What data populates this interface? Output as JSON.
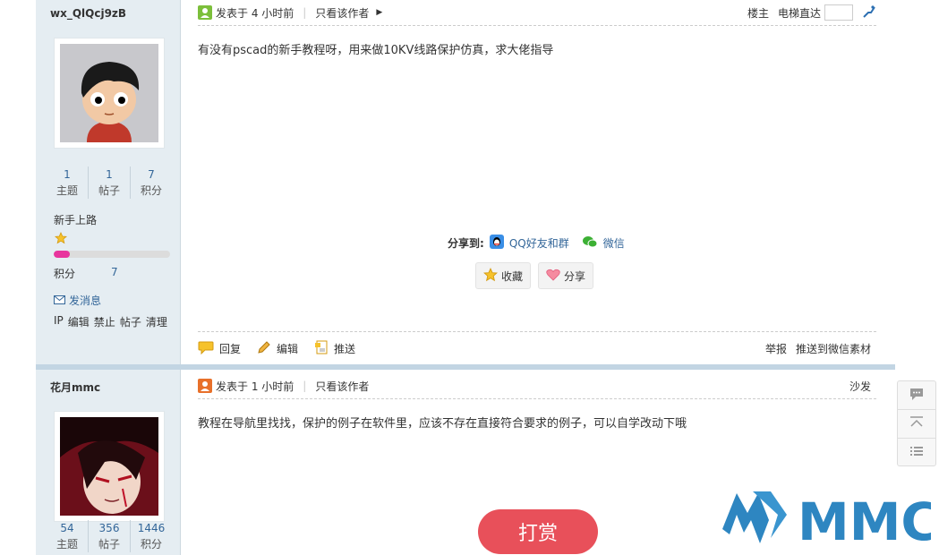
{
  "posts": [
    {
      "author": {
        "name": "wx_QlQcj9zB",
        "stats": [
          {
            "value": "1",
            "label": "主题"
          },
          {
            "value": "1",
            "label": "帖子"
          },
          {
            "value": "7",
            "label": "积分"
          }
        ],
        "level": "新手上路",
        "points_label": "积分",
        "points_value": "7",
        "send_message": "发消息",
        "admin_links": [
          "IP",
          "编辑",
          "禁止",
          "帖子",
          "清理"
        ]
      },
      "meta": {
        "posted": "发表于 4 小时前",
        "only_author": "只看该作者",
        "floor": "楼主",
        "jump_label": "电梯直达"
      },
      "content": "有没有pscad的新手教程呀，用来做10KV线路保护仿真，求大佬指导",
      "share": {
        "label": "分享到:",
        "qq": "QQ好友和群",
        "wechat": "微信"
      },
      "favorite": "收藏",
      "share_button": "分享",
      "actions": {
        "reply": "回复",
        "edit": "编辑",
        "push": "推送",
        "report": "举报",
        "push_wechat": "推送到微信素材"
      }
    },
    {
      "author": {
        "name": "花月mmc",
        "stats": [
          {
            "value": "54",
            "label": "主题"
          },
          {
            "value": "356",
            "label": "帖子"
          },
          {
            "value": "1446",
            "label": "积分"
          }
        ]
      },
      "meta": {
        "posted": "发表于 1 小时前",
        "only_author": "只看该作者",
        "floor": "沙发"
      },
      "content": "教程在导航里找找，保护的例子在软件里，应该不存在直接符合要求的例子，可以自学改动下哦"
    }
  ],
  "reward_button": "打赏",
  "watermark": "MMC",
  "colors": {
    "link": "#336699",
    "level_bar": "#e8359e",
    "reward": "#e8505a",
    "logo": "#2e86c1"
  },
  "level_progress": 0.14
}
